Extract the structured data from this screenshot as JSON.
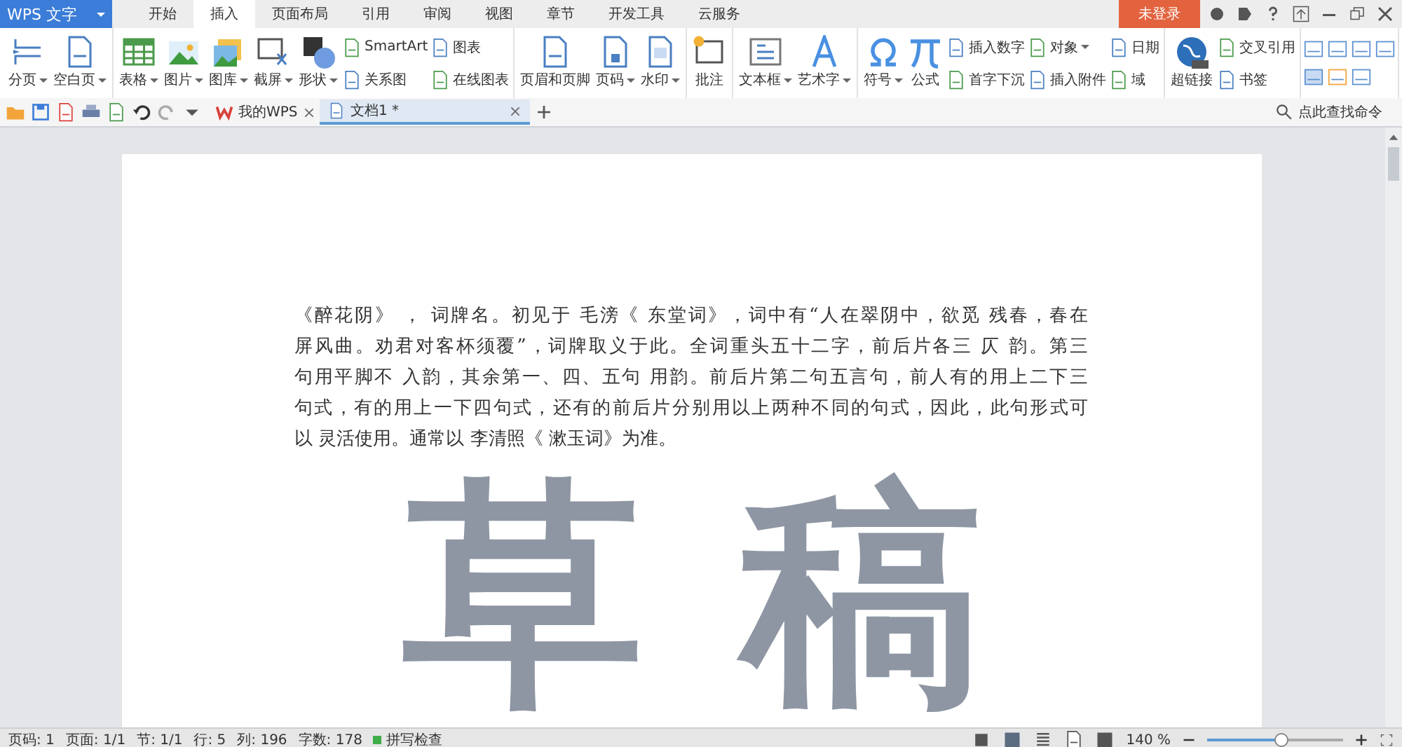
{
  "app_menu": {
    "label": "WPS 文字"
  },
  "tabs": [
    {
      "label": "开始",
      "selected": false
    },
    {
      "label": "插入",
      "selected": true
    },
    {
      "label": "页面布局",
      "selected": false
    },
    {
      "label": "引用",
      "selected": false
    },
    {
      "label": "审阅",
      "selected": false
    },
    {
      "label": "视图",
      "selected": false
    },
    {
      "label": "章节",
      "selected": false
    },
    {
      "label": "开发工具",
      "selected": false
    },
    {
      "label": "云服务",
      "selected": false
    }
  ],
  "login_button": {
    "label": "未登录"
  },
  "ribbon": {
    "groups": [
      {
        "items": [
          {
            "kind": "large",
            "label": "分页",
            "dropdown": true
          },
          {
            "kind": "large",
            "label": "空白页",
            "dropdown": true
          }
        ]
      },
      {
        "items": [
          {
            "kind": "large",
            "label": "表格",
            "dropdown": true
          },
          {
            "kind": "large",
            "label": "图片",
            "dropdown": true
          },
          {
            "kind": "large",
            "label": "图库",
            "dropdown": true
          },
          {
            "kind": "large",
            "label": "截屏",
            "dropdown": true
          },
          {
            "kind": "large",
            "label": "形状",
            "dropdown": true
          },
          {
            "kind": "stack",
            "items": [
              {
                "label": "SmartArt",
                "dropdown": false
              },
              {
                "label": "关系图",
                "dropdown": false
              }
            ]
          },
          {
            "kind": "stack",
            "items": [
              {
                "label": "图表",
                "dropdown": false
              },
              {
                "label": "在线图表",
                "dropdown": false
              }
            ]
          }
        ]
      },
      {
        "items": [
          {
            "kind": "large",
            "label": "页眉和页脚",
            "dropdown": false
          },
          {
            "kind": "large",
            "label": "页码",
            "dropdown": true
          },
          {
            "kind": "large",
            "label": "水印",
            "dropdown": true
          }
        ]
      },
      {
        "items": [
          {
            "kind": "large",
            "label": "批注",
            "dropdown": false
          }
        ]
      },
      {
        "items": [
          {
            "kind": "large",
            "label": "文本框",
            "dropdown": true
          },
          {
            "kind": "large",
            "label": "艺术字",
            "dropdown": true
          }
        ]
      },
      {
        "items": [
          {
            "kind": "large",
            "label": "符号",
            "dropdown": true
          },
          {
            "kind": "large",
            "label": "公式",
            "dropdown": false
          },
          {
            "kind": "stack",
            "items": [
              {
                "label": "插入数字",
                "dropdown": false
              },
              {
                "label": "首字下沉",
                "dropdown": false
              }
            ]
          },
          {
            "kind": "stack",
            "items": [
              {
                "label": "对象",
                "dropdown": true
              },
              {
                "label": "插入附件",
                "dropdown": false
              }
            ]
          },
          {
            "kind": "stack",
            "items": [
              {
                "label": "日期",
                "dropdown": false
              },
              {
                "label": "域",
                "dropdown": false
              }
            ]
          }
        ]
      },
      {
        "items": [
          {
            "kind": "large",
            "label": "超链接",
            "dropdown": false
          },
          {
            "kind": "stack",
            "items": [
              {
                "label": "交叉引用",
                "dropdown": false
              },
              {
                "label": "书签",
                "dropdown": false
              }
            ]
          }
        ]
      },
      {
        "items": [
          {
            "kind": "icons"
          }
        ]
      }
    ]
  },
  "command_search": {
    "placeholder": "点此查找命令"
  },
  "doc_tabs": [
    {
      "label": "我的WPS",
      "selected": false
    },
    {
      "label": "文档1 *",
      "selected": true
    }
  ],
  "document": {
    "lines": [
      "《醉花阴》 ， 词牌名。初见于 毛滂《 东堂词》，词中有“人在翠阴中，欲觅 残春，春在",
      "屏风曲。劝君对客杯须覆”，词牌取义于此。全词重头五十二字，前后片各三 仄 韵。第三",
      "句用平脚不 入韵，其余第一、四、五句 用韵。前后片第二句五言句，前人有的用上二下三",
      "句式，有的用上一下四句式，还有的前后片分别用以上两种不同的句式，因此，此句形式可",
      "以 灵活使用。通常以 李清照《 漱玉词》为准。"
    ],
    "watermark": "草稿"
  },
  "status_bar": {
    "items": [
      "页码: 1",
      "页面: 1/1",
      "节: 1/1",
      "行: 5",
      "列: 196",
      "字数: 178"
    ],
    "spell_check": "拼写检查",
    "zoom": "140 %",
    "zoom_slider": {
      "level": 0.55
    }
  }
}
